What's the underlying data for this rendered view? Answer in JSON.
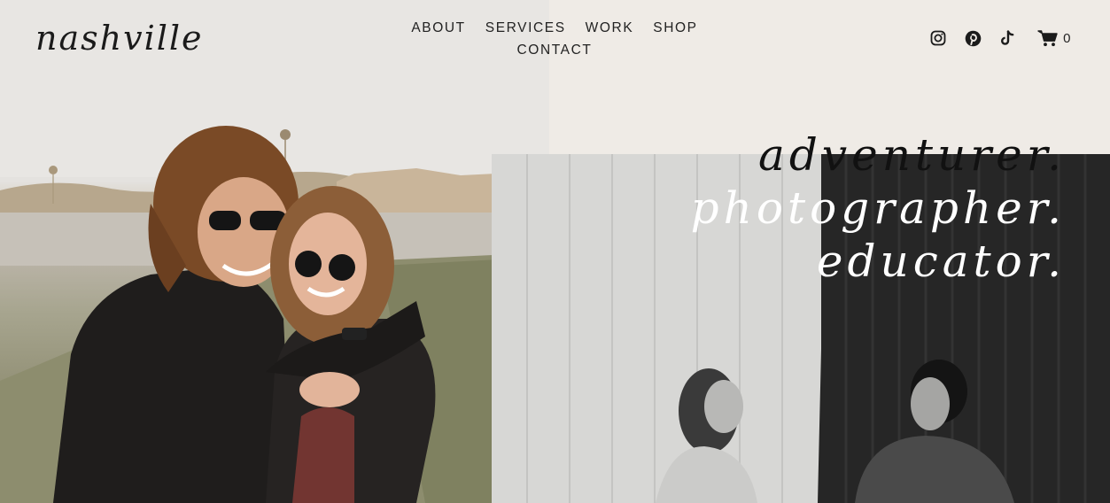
{
  "brand": {
    "logo_text": "nashville"
  },
  "nav": {
    "row1": [
      "ABOUT",
      "SERVICES",
      "WORK",
      "SHOP"
    ],
    "row2": [
      "CONTACT"
    ]
  },
  "social": {
    "icons": [
      "instagram-icon",
      "pinterest-icon",
      "tiktok-icon"
    ]
  },
  "cart": {
    "icon": "cart-icon",
    "count": "0"
  },
  "hero": {
    "tagline": [
      "adventurer.",
      "photographer.",
      "educator."
    ]
  },
  "colors": {
    "background": "#efebe6",
    "text_dark": "#1b1b1b",
    "tagline_light": "#ffffff"
  }
}
